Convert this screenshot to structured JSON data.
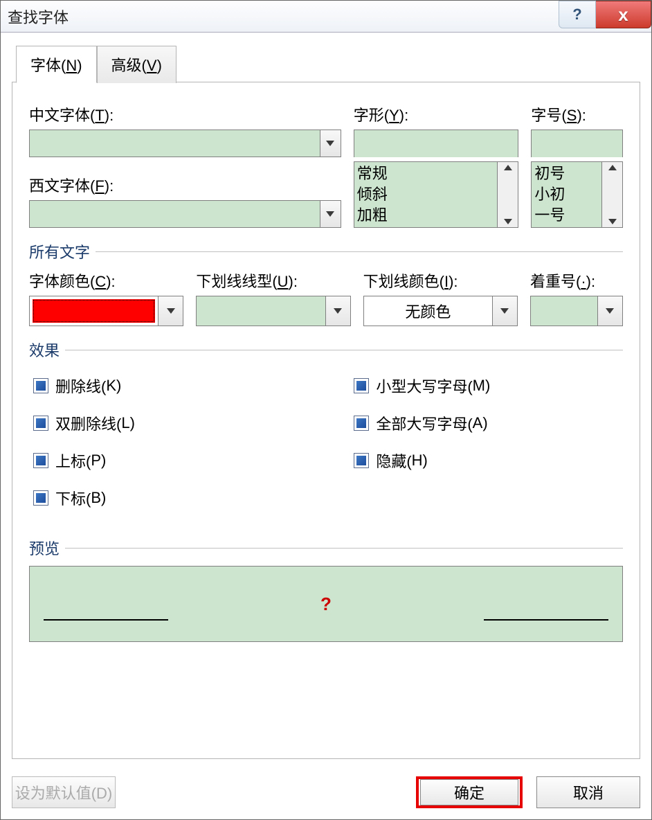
{
  "title": "查找字体",
  "tabs": {
    "font": {
      "label_pre": "字体(",
      "hotkey": "N",
      "label_post": ")"
    },
    "advanced": {
      "label_pre": "高级(",
      "hotkey": "V",
      "label_post": ")"
    }
  },
  "labels": {
    "chinese_font": {
      "pre": "中文字体(",
      "hot": "T",
      "post": "):"
    },
    "western_font": {
      "pre": "西文字体(",
      "hot": "F",
      "post": "):"
    },
    "font_style": {
      "pre": "字形(",
      "hot": "Y",
      "post": "):"
    },
    "font_size": {
      "pre": "字号(",
      "hot": "S",
      "post": "):"
    },
    "all_text": "所有文字",
    "font_color": {
      "pre": "字体颜色(",
      "hot": "C",
      "post": "):"
    },
    "underline_style": {
      "pre": "下划线线型(",
      "hot": "U",
      "post": "):"
    },
    "underline_color": {
      "pre": "下划线颜色(",
      "hot": "I",
      "post": "):"
    },
    "emphasis": {
      "pre": "着重号(",
      "hot": "·",
      "post": "):"
    },
    "effects": "效果",
    "preview": "预览"
  },
  "font_style_items": [
    "常规",
    "倾斜",
    "加粗"
  ],
  "font_size_items": [
    "初号",
    "小初",
    "一号"
  ],
  "underline_color_value": "无颜色",
  "font_color_value": "#ff0000",
  "effects_left": [
    {
      "pre": "删除线(",
      "hot": "K",
      "post": ")"
    },
    {
      "pre": "双删除线(",
      "hot": "L",
      "post": ")"
    },
    {
      "pre": "上标(",
      "hot": "P",
      "post": ")"
    },
    {
      "pre": "下标(",
      "hot": "B",
      "post": ")"
    }
  ],
  "effects_right": [
    {
      "pre": "小型大写字母(",
      "hot": "M",
      "post": ")"
    },
    {
      "pre": "全部大写字母(",
      "hot": "A",
      "post": ")"
    },
    {
      "pre": "隐藏(",
      "hot": "H",
      "post": ")"
    }
  ],
  "preview_mark": "?",
  "buttons": {
    "set_default": "设为默认值(D)",
    "ok": "确定",
    "cancel": "取消"
  }
}
